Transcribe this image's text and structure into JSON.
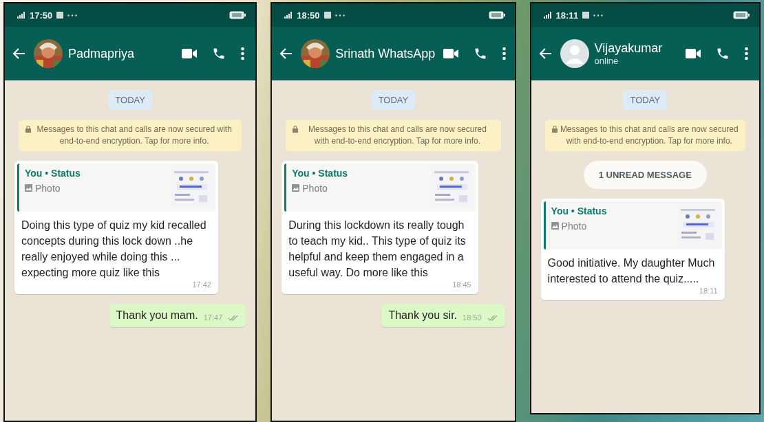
{
  "phones": [
    {
      "status_time": "17:50",
      "contact": {
        "name": "Padmapriya"
      },
      "messages": [
        {
          "kind": "date",
          "text": "TODAY"
        },
        {
          "kind": "system",
          "text": "Messages to this chat and calls are now secured with end-to-end encryption. Tap for more info."
        },
        {
          "kind": "incoming",
          "quote_author": "You • Status",
          "quote_label": "Photo",
          "text": "Doing this type of  quiz my kid recalled concepts during this lock down ..he really enjoyed while doing this ... expecting more quiz like this",
          "time": "17:42"
        },
        {
          "kind": "outgoing",
          "text": "Thank you mam.",
          "time": "17:47"
        }
      ]
    },
    {
      "status_time": "18:50",
      "contact": {
        "name": "Srinath WhatsApp"
      },
      "messages": [
        {
          "kind": "date",
          "text": "TODAY"
        },
        {
          "kind": "system",
          "text": "Messages to this chat and calls are now secured with end-to-end encryption. Tap for more info."
        },
        {
          "kind": "incoming",
          "quote_author": "You • Status",
          "quote_label": "Photo",
          "text": "During this lockdown its really tough to teach my kid.. This type of quiz its helpful and keep them engaged in a useful way. Do more like this",
          "time": "18:45"
        },
        {
          "kind": "outgoing",
          "text": "Thank you sir.",
          "time": "18:50"
        }
      ]
    },
    {
      "status_time": "18:11",
      "contact": {
        "name": "Vijayakumar",
        "subtitle": "online",
        "avatar": {
          "kind": "default"
        }
      },
      "messages": [
        {
          "kind": "date",
          "text": "TODAY"
        },
        {
          "kind": "system",
          "text": "Messages to this chat and calls are now secured with end-to-end encryption. Tap for more info."
        },
        {
          "kind": "unread",
          "text": "1 UNREAD MESSAGE"
        },
        {
          "kind": "incoming",
          "quote_author": "You • Status",
          "quote_label": "Photo",
          "text": "Good initiative.  My daughter Much interested  to attend the quiz.....",
          "time": "18:11"
        }
      ]
    }
  ]
}
